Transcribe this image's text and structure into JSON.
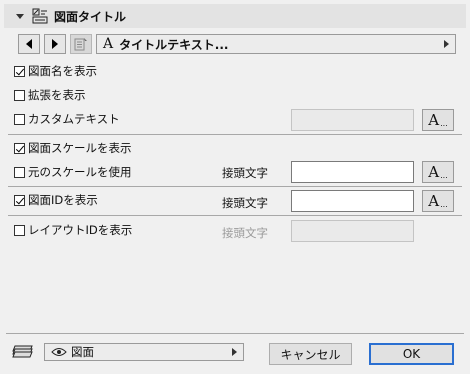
{
  "header": {
    "title": "図面タイトル",
    "icon": "drawing-title-icon"
  },
  "toolbar": {
    "dropdown_label": "タイトルテキスト...",
    "font_symbol": "A"
  },
  "options": {
    "show_drawing_name": {
      "label": "図面名を表示",
      "checked": true
    },
    "show_extension": {
      "label": "拡張を表示",
      "checked": false
    },
    "custom_text": {
      "label": "カスタムテキスト",
      "checked": false,
      "value": ""
    },
    "show_drawing_scale": {
      "label": "図面スケールを表示",
      "checked": true
    },
    "use_original_scale": {
      "label": "元のスケールを使用",
      "checked": false,
      "prefix_label": "接頭文字",
      "value": ""
    },
    "show_drawing_id": {
      "label": "図面IDを表示",
      "checked": true,
      "prefix_label": "接頭文字",
      "value": ""
    },
    "show_layout_id": {
      "label": "レイアウトIDを表示",
      "checked": false,
      "prefix_label": "接頭文字",
      "value": ""
    }
  },
  "font_button": {
    "glyph": "A",
    "dots": "..."
  },
  "footer": {
    "view_label": "図面",
    "cancel_label": "キャンセル",
    "ok_label": "OK"
  }
}
